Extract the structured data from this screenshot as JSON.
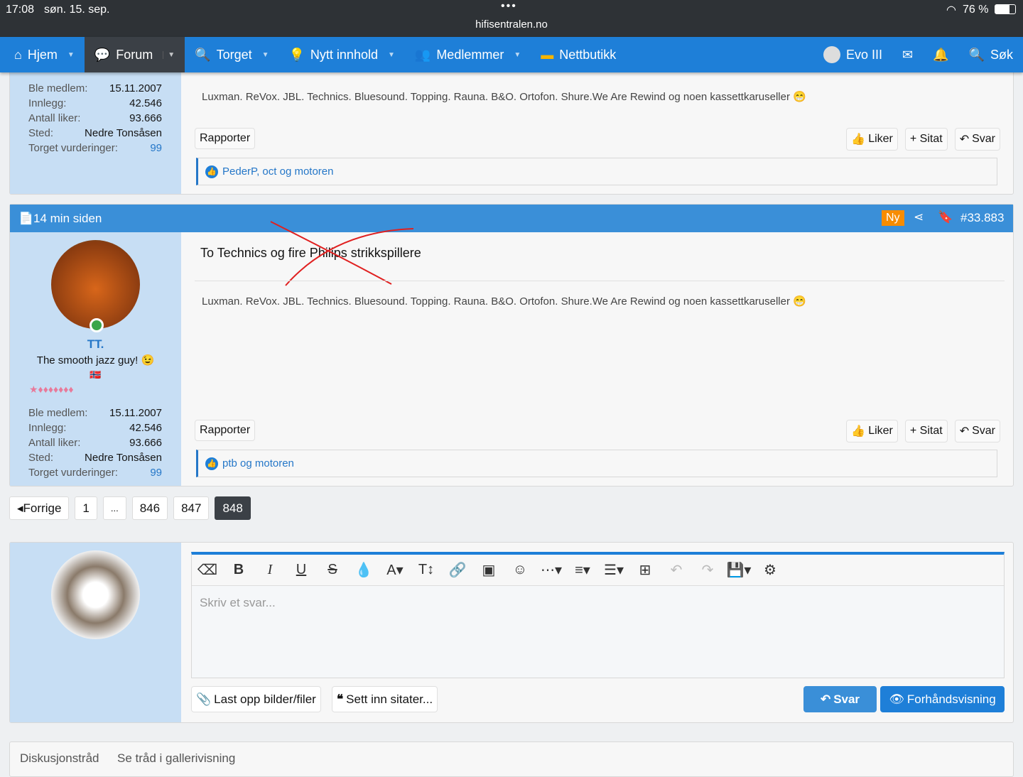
{
  "status": {
    "time": "17:08",
    "date": "søn. 15. sep.",
    "url": "hifisentralen.no",
    "battery": "76 %"
  },
  "nav": {
    "items": [
      {
        "label": "Hjem",
        "icon": "home-icon"
      },
      {
        "label": "Forum",
        "icon": "comments-icon",
        "active": true
      },
      {
        "label": "Torget",
        "icon": "search-dollar-icon"
      },
      {
        "label": "Nytt innhold",
        "icon": "lightbulb-icon"
      },
      {
        "label": "Medlemmer",
        "icon": "users-icon"
      },
      {
        "label": "Nettbutikk",
        "icon": "shop-icon"
      }
    ],
    "user": "Evo III",
    "search": "Søk"
  },
  "user_stats": [
    {
      "label": "Ble medlem:",
      "value": "15.11.2007"
    },
    {
      "label": "Innlegg:",
      "value": "42.546"
    },
    {
      "label": "Antall liker:",
      "value": "93.666"
    },
    {
      "label": "Sted:",
      "value": "Nedre Tonsåsen"
    },
    {
      "label": "Torget vurderinger:",
      "value": "99"
    }
  ],
  "signature": "Luxman. ReVox. JBL. Technics. Bluesound. Topping. Rauna. B&O. Ortofon. Shure.We Are Rewind og noen kassettkaruseller 😁",
  "actions": {
    "report": "Rapporter",
    "like": "Liker",
    "quote": "+ Sitat",
    "reply": "Svar"
  },
  "post1": {
    "likes": "PederP, oct og motoren"
  },
  "post2": {
    "time": "14 min siden",
    "badge": "Ny",
    "number": "#33.883",
    "username": "TT.",
    "user_title": "The smooth jazz guy! 😉",
    "flag": "🇳🇴",
    "message": "To Technics og fire Philips strikkspillere",
    "likes": "ptb og motoren",
    "accent": "#3a8fd8"
  },
  "pagination": {
    "prev": "Forrige",
    "pages": [
      "1",
      "...",
      "846",
      "847",
      "848"
    ],
    "current": "848"
  },
  "editor": {
    "placeholder": "Skriv et svar...",
    "upload": "Last opp bilder/filer",
    "insert_quotes": "Sett inn sitater...",
    "submit": "Svar",
    "preview": "Forhåndsvisning"
  },
  "footer": {
    "tabs": [
      "Diskusjonstråd",
      "Se tråd i gallerivisning"
    ]
  }
}
